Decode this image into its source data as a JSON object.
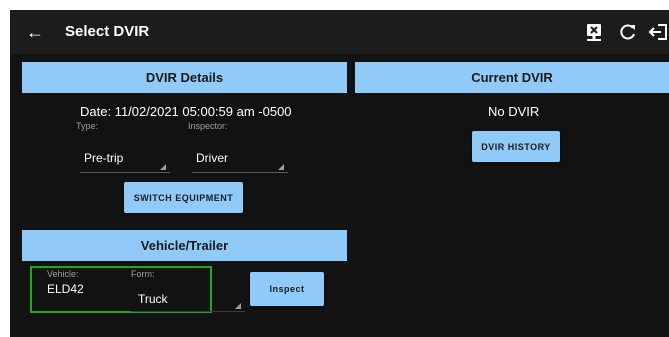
{
  "appbar": {
    "title": "Select DVIR",
    "back_icon": "arrow-left-icon",
    "actions": [
      "monitor-close-icon",
      "refresh-icon",
      "logout-icon"
    ]
  },
  "dvir_details": {
    "header": "DVIR Details",
    "date_text": "Date: 11/02/2021 05:00:59 am -0500",
    "type_label": "Type:",
    "inspector_label": "Inspector:",
    "type_value": "Pre-trip",
    "inspector_value": "Driver",
    "switch_button": "SWITCH EQUIPMENT"
  },
  "current_dvir": {
    "header": "Current DVIR",
    "status": "No DVIR",
    "history_button": "DVIR HISTORY"
  },
  "vehicle_trailer": {
    "header": "Vehicle/Trailer",
    "vehicle_label": "Vehicle:",
    "vehicle_value": "ELD42",
    "form_label": "Form:",
    "form_value": "Truck",
    "inspect_button": "Inspect"
  },
  "colors": {
    "background": "#121212",
    "appbar": "#1c1c1c",
    "accent": "#90caf9",
    "highlight": "#1fa81f"
  }
}
